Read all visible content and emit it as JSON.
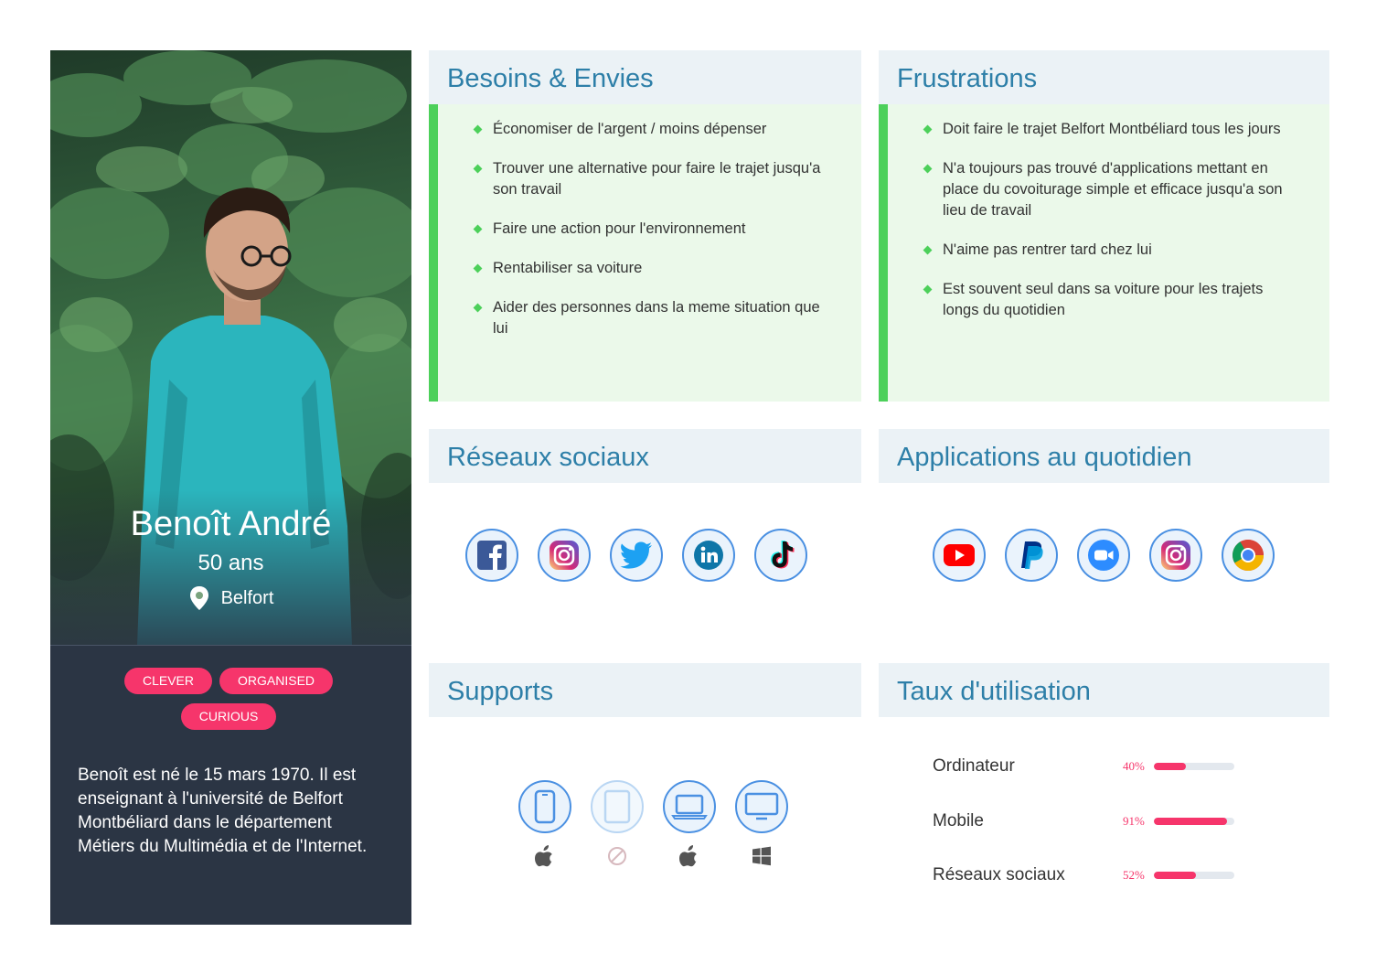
{
  "profile": {
    "name": "Benoît André",
    "age": "50 ans",
    "location": "Belfort",
    "tags": [
      "CLEVER",
      "ORGANISED",
      "CURIOUS"
    ],
    "bio": "Benoît est né le 15 mars 1970. Il est enseignant à l'université de Belfort Montbéliard dans le département Métiers du Multimédia et de l'Internet."
  },
  "needs": {
    "title": "Besoins & Envies",
    "items": [
      "Économiser de l'argent / moins dépenser",
      "Trouver une alternative pour faire le trajet jusqu'a son travail",
      "Faire une action pour l'environnement",
      "Rentabiliser sa voiture",
      "Aider des personnes dans la meme situation que lui"
    ]
  },
  "frustrations": {
    "title": "Frustrations",
    "items": [
      "Doit faire le trajet Belfort Montbéliard tous les jours",
      "N'a toujours pas trouvé d'applications mettant en place du covoiturage simple et efficace jusqu'a son lieu de travail",
      "N'aime pas rentrer tard chez lui",
      "Est souvent seul dans sa voiture pour les trajets longs du quotidien"
    ]
  },
  "social": {
    "title": "Réseaux sociaux",
    "icons": [
      "facebook-icon",
      "instagram-icon",
      "twitter-icon",
      "linkedin-icon",
      "tiktok-icon"
    ]
  },
  "apps": {
    "title": "Applications au quotidien",
    "icons": [
      "youtube-icon",
      "paypal-icon",
      "zoom-icon",
      "instagram-icon",
      "chrome-icon"
    ]
  },
  "supports": {
    "title": "Supports",
    "devices": [
      {
        "device": "phone-icon",
        "os": "apple-icon",
        "enabled": true
      },
      {
        "device": "tablet-icon",
        "os": "forbidden-icon",
        "enabled": false
      },
      {
        "device": "laptop-icon",
        "os": "apple-icon",
        "enabled": true
      },
      {
        "device": "desktop-icon",
        "os": "windows-icon",
        "enabled": true
      }
    ]
  },
  "usage": {
    "title": "Taux d'utilisation",
    "items": [
      {
        "label": "Ordinateur",
        "percent_text": "40%",
        "value": 40
      },
      {
        "label": "Mobile",
        "percent_text": "91%",
        "value": 91
      },
      {
        "label": "Réseaux sociaux",
        "percent_text": "52%",
        "value": 52
      }
    ]
  },
  "colors": {
    "accent_pink": "#f6356b",
    "heading_blue": "#2d7fa8",
    "green": "#4cd05a",
    "card_dark": "#2b3544"
  }
}
